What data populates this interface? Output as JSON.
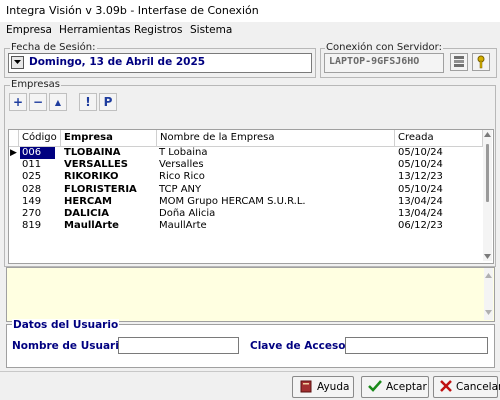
{
  "window": {
    "title": "Integra Visión v 3.09b - Interfase de Conexión"
  },
  "menu": [
    "Empresa",
    "Herramientas",
    "Registros",
    "Sistema"
  ],
  "session": {
    "legend": "Fecha de Sesión:",
    "date_value": "Domingo, 13 de Abril de 2025"
  },
  "server": {
    "legend": "Conexión con Servidor:",
    "name": "LAPTOP-9GFSJ6HO"
  },
  "empresas": {
    "legend": "Empresas",
    "toolbar": [
      "+",
      "−",
      "▲",
      "!",
      "P"
    ],
    "columns": [
      "Código",
      "Empresa",
      "Nombre de la Empresa",
      "Creada"
    ],
    "rows": [
      {
        "codigo": "006",
        "empresa": "TLOBAINA",
        "nombre": "T Lobaina",
        "creada": "05/10/24"
      },
      {
        "codigo": "011",
        "empresa": "VERSALLES",
        "nombre": "Versalles",
        "creada": "05/10/24"
      },
      {
        "codigo": "025",
        "empresa": "RIKORIKO",
        "nombre": "Rico Rico",
        "creada": "13/12/23"
      },
      {
        "codigo": "028",
        "empresa": "FLORISTERIA",
        "nombre": "TCP ANY",
        "creada": "05/10/24"
      },
      {
        "codigo": "149",
        "empresa": "HERCAM",
        "nombre": "MOM Grupo HERCAM S.U.R.L.",
        "creada": "13/04/24"
      },
      {
        "codigo": "270",
        "empresa": "DALICIA",
        "nombre": "Doña Alicia",
        "creada": "13/04/24"
      },
      {
        "codigo": "819",
        "empresa": "MaullArte",
        "nombre": "MaullArte",
        "creada": "06/12/23"
      }
    ],
    "selected_index": 0
  },
  "user": {
    "legend": "Datos del Usuario",
    "username_label": "Nombre de Usuario:",
    "password_label": "Clave de Acceso:",
    "username_value": "",
    "password_value": ""
  },
  "buttons": {
    "help": "Ayuda",
    "accept": "Aceptar",
    "cancel": "Cancelar"
  },
  "colors": {
    "accent_text": "#000080",
    "memo_bg": "#ffffe1",
    "selection_bg": "#000080"
  }
}
